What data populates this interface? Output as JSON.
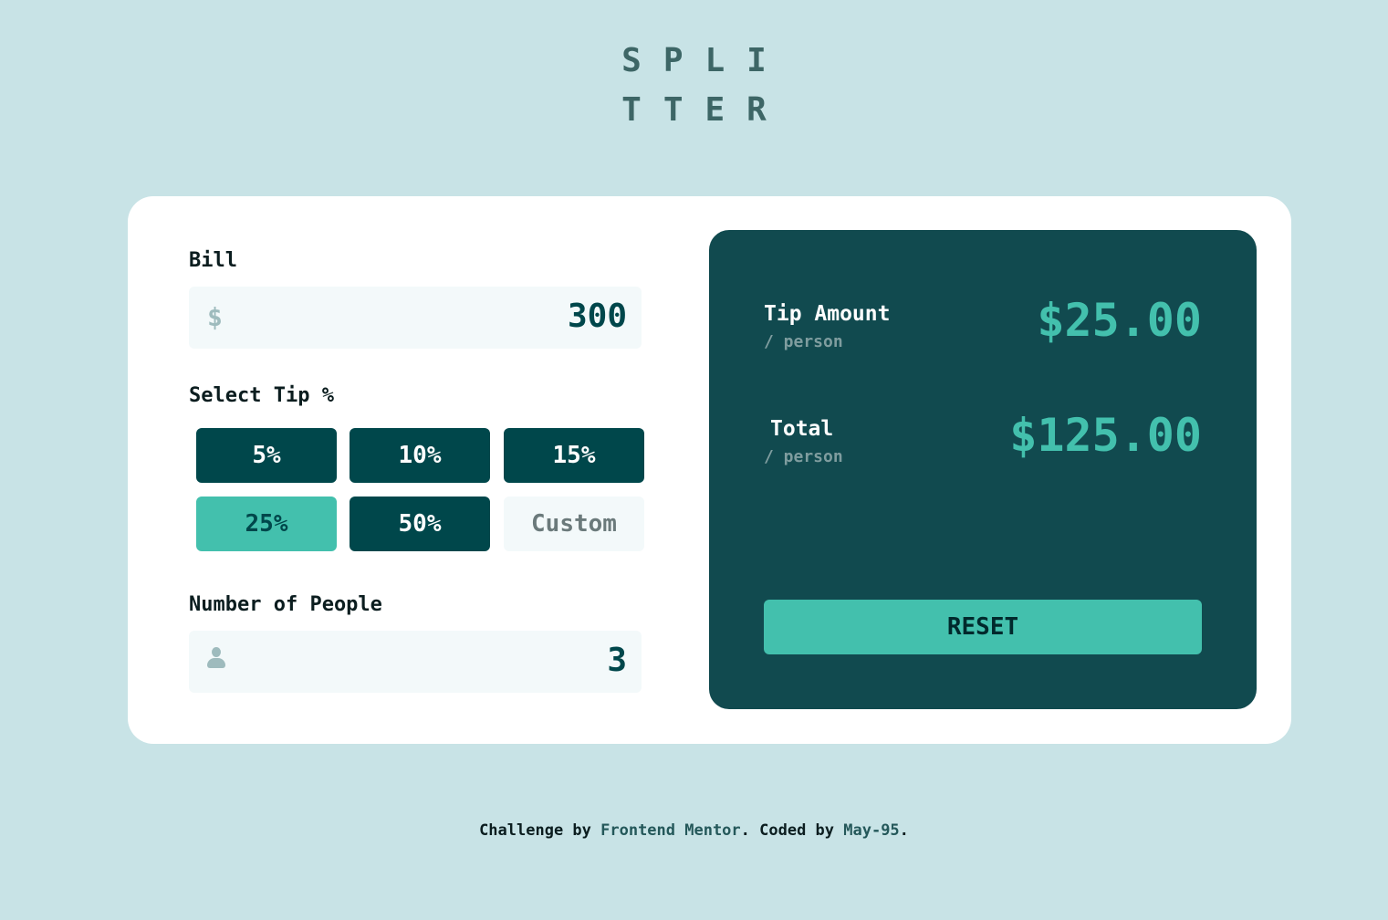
{
  "logo": {
    "line1": "SPLI",
    "line2": "TTER"
  },
  "bill": {
    "label": "Bill",
    "currency_icon": "dollar-icon",
    "currency_symbol": "$",
    "value": "300"
  },
  "tip": {
    "label": "Select Tip %",
    "options": [
      "5%",
      "10%",
      "15%",
      "25%",
      "50%"
    ],
    "selected": "25%",
    "custom_placeholder": "Custom"
  },
  "people": {
    "label": "Number of People",
    "icon": "person-icon",
    "value": "3"
  },
  "results": {
    "tip_amount": {
      "title": "Tip Amount",
      "sub": "/ person",
      "value": "$25.00"
    },
    "total": {
      "title": "Total",
      "sub": "/ person",
      "value": "$125.00"
    },
    "reset_label": "RESET"
  },
  "footer": {
    "prefix": "Challenge by ",
    "link1": "Frontend Mentor",
    "middle": ". Coded by ",
    "link2": "May-95",
    "suffix": "."
  },
  "colors": {
    "background": "#c8e3e6",
    "dark_cyan": "#00474b",
    "strong_cyan": "#43c0ad",
    "result_panel": "#114a4f",
    "input_bg": "#f3f9fa"
  }
}
